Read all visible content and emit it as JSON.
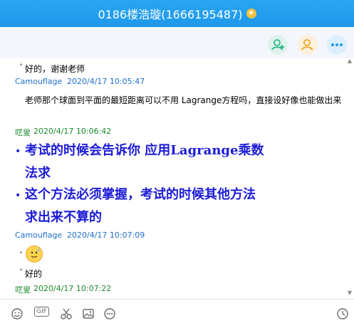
{
  "window": {
    "title": "0186楼浩璇(1666195487)"
  },
  "toolbar": {
    "buttons": [
      {
        "name": "add-friend",
        "icon": "add-user-icon",
        "color": "#2ab88b"
      },
      {
        "name": "profile",
        "icon": "user-icon",
        "color": "#f0a62a"
      },
      {
        "name": "more",
        "icon": "more-icon",
        "color": "#1f98ea"
      }
    ]
  },
  "messages": [
    {
      "kind": "text",
      "text": "好的，谢谢老师"
    },
    {
      "kind": "sender",
      "sender": "Camouflage",
      "time": "2020/4/17 10:05:47"
    },
    {
      "kind": "text",
      "text": "老师那个球面到平面的最短距离可以不用 Lagrange方程吗，直接设好像也能做出来"
    },
    {
      "kind": "sender",
      "sender": "呓叟",
      "time": "2020/4/17 10:06:42"
    },
    {
      "kind": "big",
      "line1": "考试的时候会告诉你 应用Lagrange乘数",
      "line2": "法求"
    },
    {
      "kind": "big",
      "line1": "这个方法必须掌握，考试的时候其他方法",
      "line2": "求出来不算的"
    },
    {
      "kind": "sender",
      "sender": "Camouflage",
      "time": "2020/4/17 10:07:09"
    },
    {
      "kind": "emoji",
      "icon": "sweat-smile-emoji"
    },
    {
      "kind": "text",
      "text": "好的"
    },
    {
      "kind": "sender",
      "sender": "呓叟",
      "time": "2020/4/17 10:07:22"
    }
  ],
  "composer": {
    "icons": [
      "emoji-icon",
      "gif-icon",
      "scissors-icon",
      "image-icon",
      "more-icon",
      "history-icon"
    ],
    "gif_label": "GIF"
  },
  "colors": {
    "title_bar": "#1f98ea",
    "sender_camouflage": "#1f6fca",
    "sender_laoshi": "#1b8c2b",
    "big_text": "#1c1cd8"
  }
}
